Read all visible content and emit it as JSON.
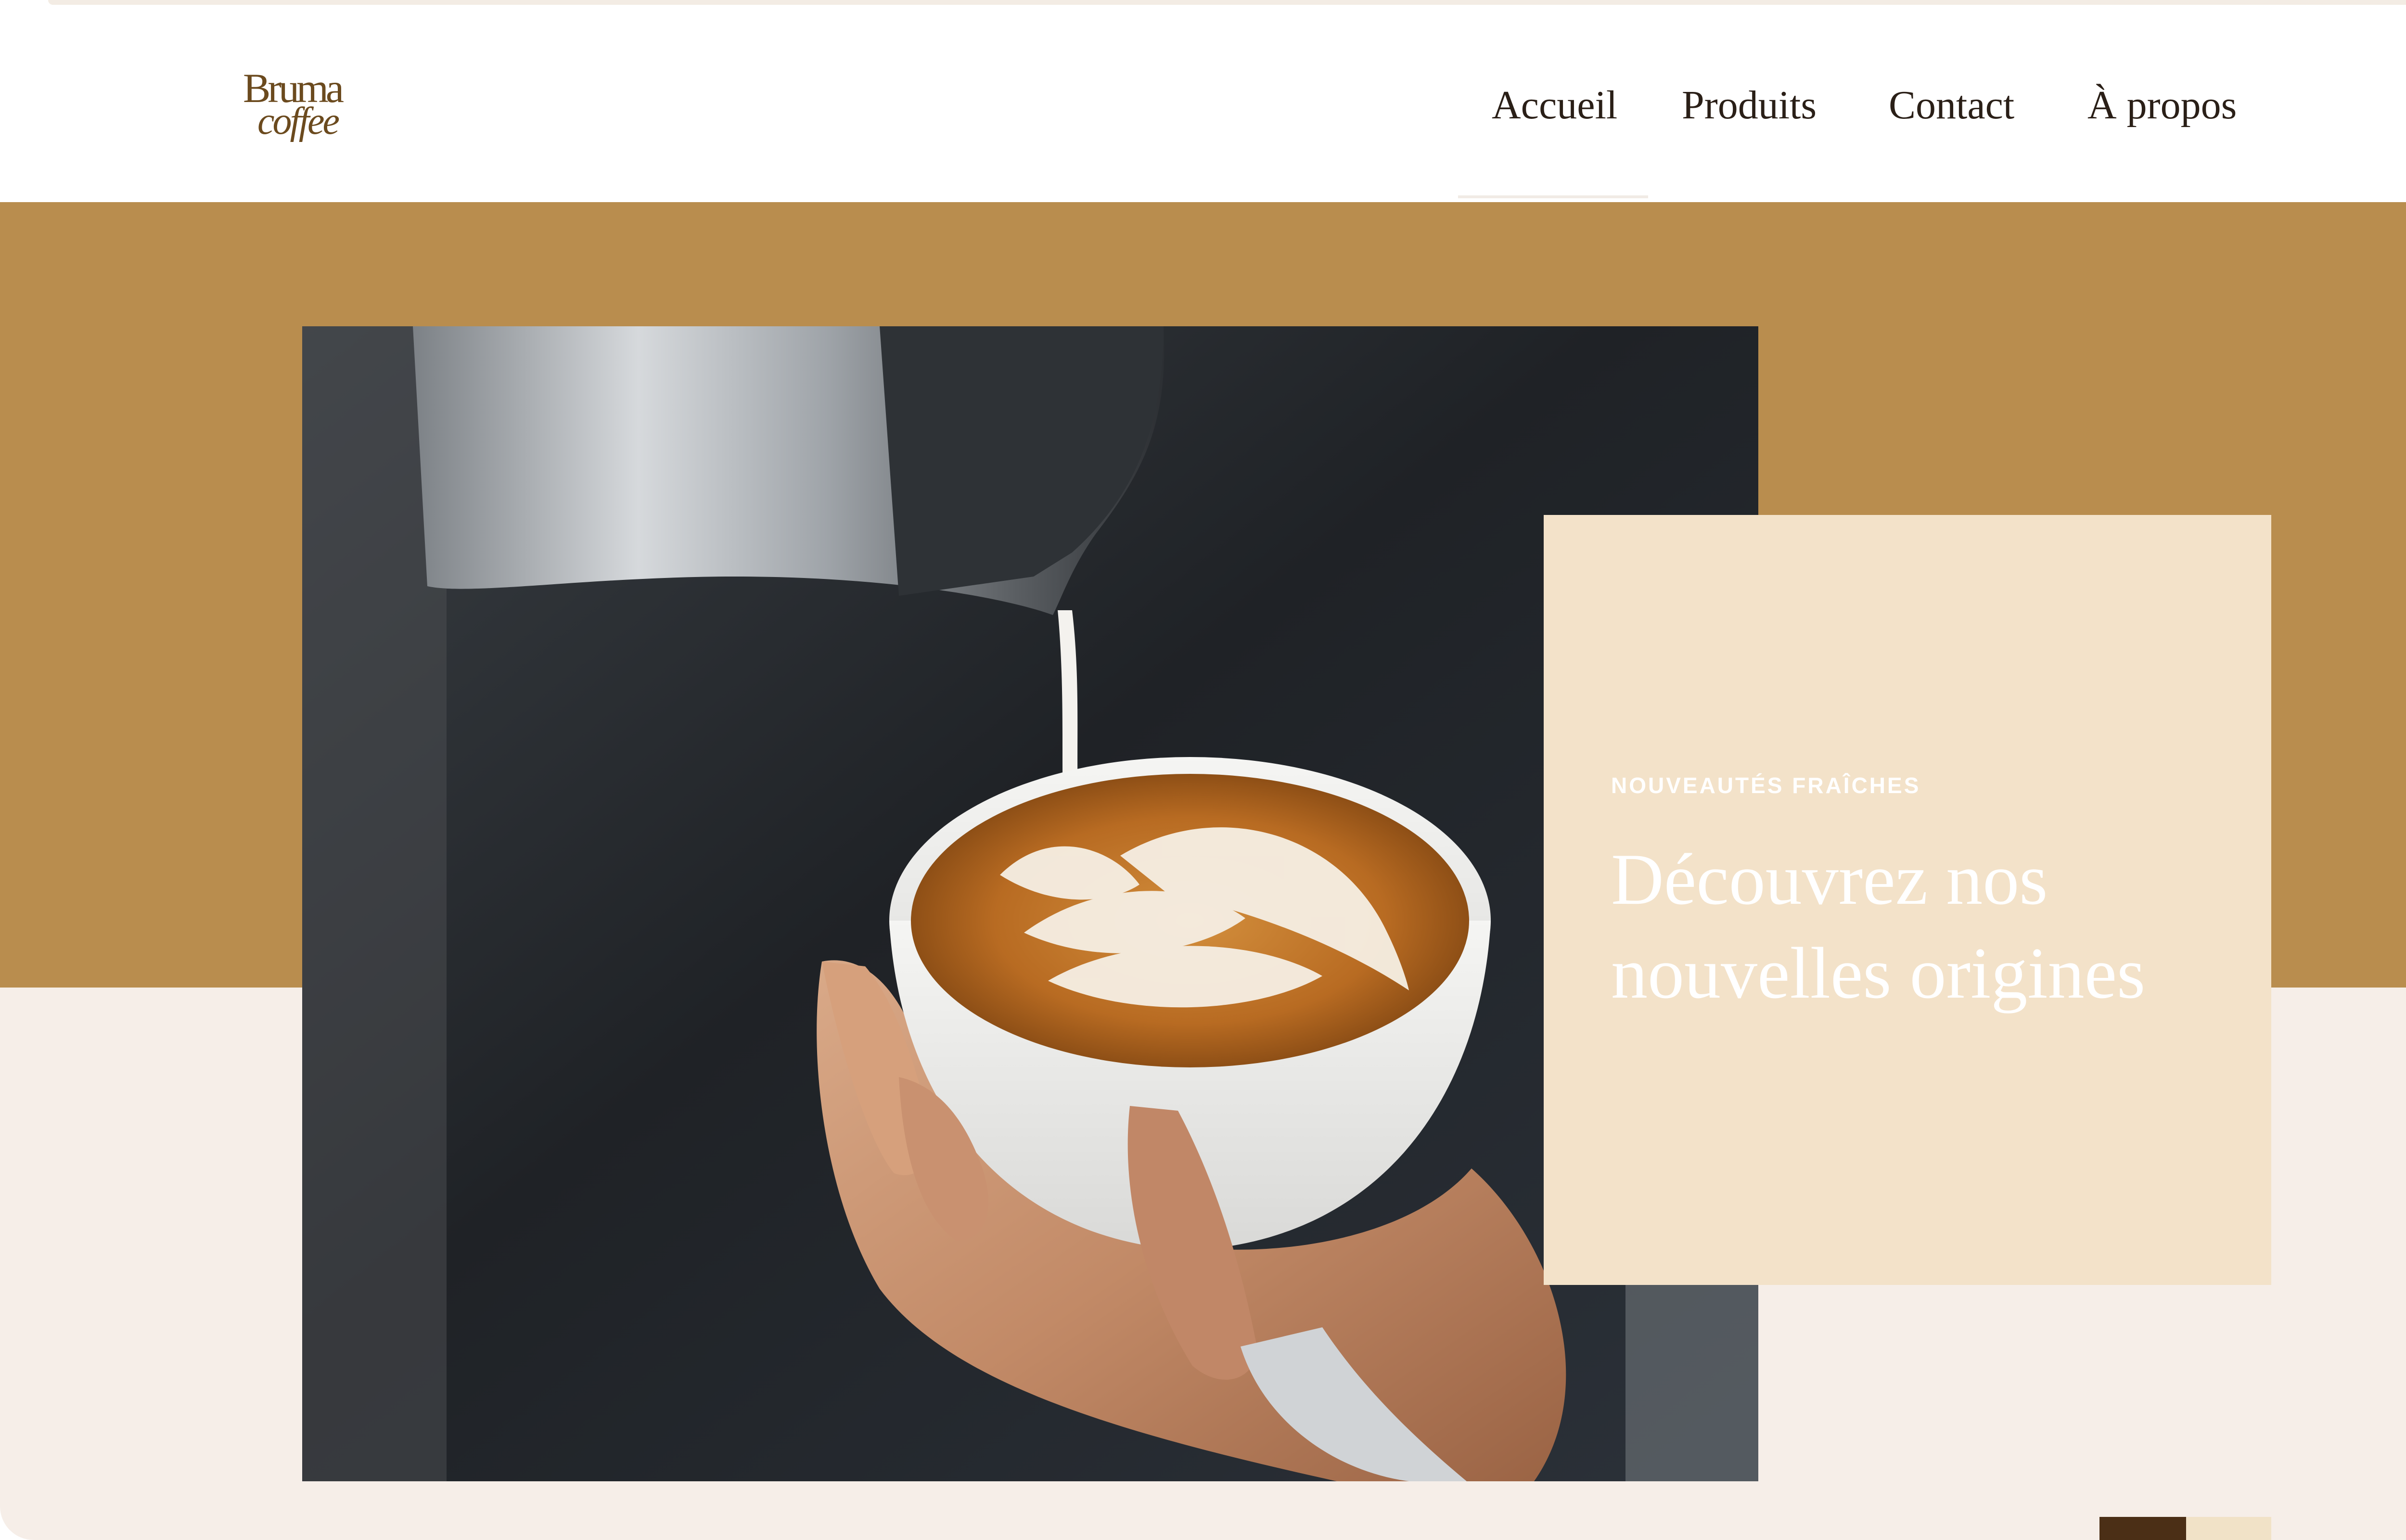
{
  "brand": {
    "logo_line1": "Bruma",
    "logo_line2": "coffee"
  },
  "nav": {
    "items": [
      {
        "label": "Accueil",
        "active": true
      },
      {
        "label": "Produits",
        "active": false
      },
      {
        "label": "Contact",
        "active": false
      },
      {
        "label": "À propos",
        "active": false
      }
    ]
  },
  "hero": {
    "image_subject": "latte art being poured into a white cup",
    "card": {
      "eyebrow": "NOUVEAUTÉS FRAÎCHES",
      "title": "Découvrez nos nouvelles origines"
    },
    "slider": {
      "count": 2,
      "active_index": 0
    }
  },
  "colors": {
    "gold": "#b98d4e",
    "cream": "#f6eee8",
    "card": "#f3e2c9",
    "logo": "#6b4a1e",
    "slider_active": "#4b2f16",
    "slider_inactive": "#f1e2c7"
  }
}
